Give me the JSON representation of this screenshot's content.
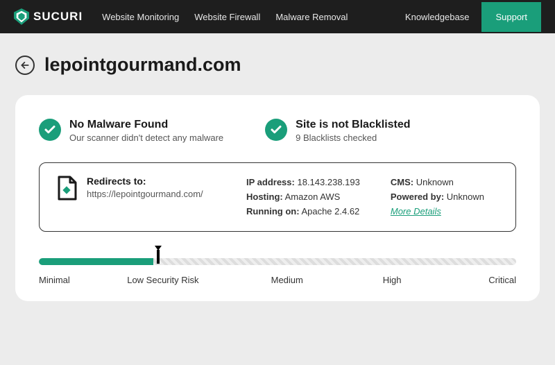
{
  "header": {
    "brand": "SUCURI",
    "nav": {
      "monitoring": "Website Monitoring",
      "firewall": "Website Firewall",
      "malware": "Malware Removal"
    },
    "kb": "Knowledgebase",
    "support": "Support"
  },
  "page": {
    "domain": "lepointgourmand.com"
  },
  "status": {
    "malware": {
      "title": "No Malware Found",
      "subtitle": "Our scanner didn't detect any malware"
    },
    "blacklist": {
      "title": "Site is not Blacklisted",
      "subtitle": "9 Blacklists checked"
    }
  },
  "details": {
    "redirect_label": "Redirects to:",
    "redirect_url": "https://lepointgourmand.com/",
    "ip_label": "IP address:",
    "ip_value": "18.143.238.193",
    "hosting_label": "Hosting:",
    "hosting_value": "Amazon AWS",
    "running_label": "Running on:",
    "running_value": "Apache 2.4.62",
    "cms_label": "CMS:",
    "cms_value": "Unknown",
    "powered_label": "Powered by:",
    "powered_value": "Unknown",
    "more": "More Details"
  },
  "risk": {
    "fill_percent": 24,
    "marker_percent": 25,
    "labels": {
      "minimal": "Minimal",
      "low": "Low Security Risk",
      "medium": "Medium",
      "high": "High",
      "critical": "Critical"
    }
  }
}
